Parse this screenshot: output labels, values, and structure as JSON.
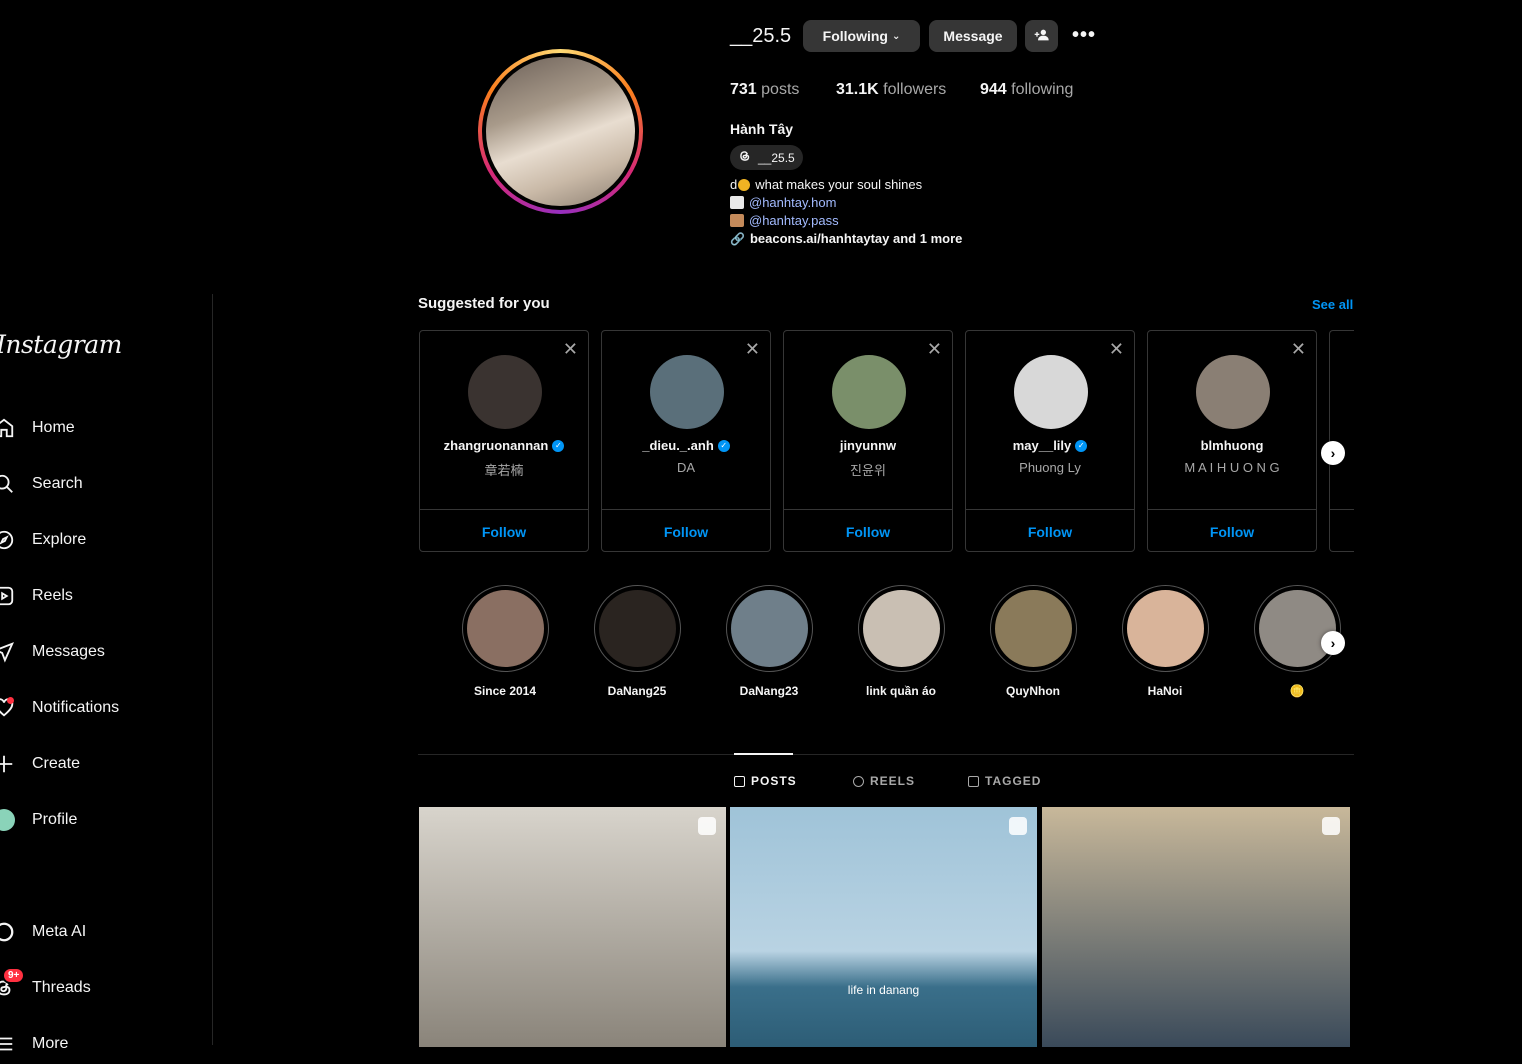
{
  "sidebar": {
    "logo": "Instagram",
    "items": [
      {
        "label": "Home",
        "icon": "home-icon"
      },
      {
        "label": "Search",
        "icon": "search-icon"
      },
      {
        "label": "Explore",
        "icon": "compass-icon"
      },
      {
        "label": "Reels",
        "icon": "reels-icon"
      },
      {
        "label": "Messages",
        "icon": "send-icon"
      },
      {
        "label": "Notifications",
        "icon": "heart-icon"
      },
      {
        "label": "Create",
        "icon": "plus-icon"
      },
      {
        "label": "Profile",
        "icon": "avatar"
      },
      {
        "label": "Meta AI",
        "icon": "meta-ai-icon"
      },
      {
        "label": "Threads",
        "icon": "threads-icon",
        "badge": "9+"
      },
      {
        "label": "More",
        "icon": "menu-icon"
      }
    ]
  },
  "profile": {
    "username": "__25.5",
    "following_btn": "Following",
    "message_btn": "Message",
    "posts_count": "731",
    "posts_label": "posts",
    "followers_count": "31.1K",
    "followers_label": "followers",
    "following_count": "944",
    "following_label": "following",
    "full_name": "Hành Tây",
    "threads_handle": "__25.5",
    "bio_line1": "what makes your soul shines",
    "bio_line1_prefix": "d",
    "bio_link1": "@hanhtay.hom",
    "bio_link2": "@hanhtay.pass",
    "bio_link3": "beacons.ai/hanhtaytay and 1 more"
  },
  "suggested": {
    "title": "Suggested for you",
    "see_all": "See all",
    "follow_label": "Follow",
    "cards": [
      {
        "username": "zhangruonannan",
        "subtitle": "章若楠",
        "verified": true,
        "color": "#3a3330"
      },
      {
        "username": "_dieu._.anh",
        "subtitle": "DA",
        "verified": true,
        "color": "#5a6f7a"
      },
      {
        "username": "jinyunnw",
        "subtitle": "진윤위",
        "verified": false,
        "color": "#7a8f6a"
      },
      {
        "username": "may__lily",
        "subtitle": "Phuong Ly",
        "verified": true,
        "color": "#d8d8d8"
      },
      {
        "username": "blmhuong",
        "subtitle": "M A I H U O N G",
        "verified": false,
        "color": "#8a7f74"
      }
    ]
  },
  "highlights": [
    {
      "label": "Since 2014",
      "color": "#8a6f62"
    },
    {
      "label": "DaNang25",
      "color": "#2a2420"
    },
    {
      "label": "DaNang23",
      "color": "#6f7f8a"
    },
    {
      "label": "link quần áo",
      "color": "#c9bfb3"
    },
    {
      "label": "QuyNhon",
      "color": "#8a7a5a"
    },
    {
      "label": "HaNoi",
      "color": "#d9b49a"
    },
    {
      "label": "🪙",
      "color": "#8f8a84"
    }
  ],
  "tabs": [
    {
      "label": "POSTS",
      "active": true
    },
    {
      "label": "REELS",
      "active": false
    },
    {
      "label": "TAGGED",
      "active": false
    }
  ],
  "posts": [
    {
      "caption": "",
      "color_top": "#d8d4cc",
      "color_bottom": "#8a847a"
    },
    {
      "caption": "life in danang",
      "color_top": "#9fc3d8",
      "color_bottom": "#3a6f8a"
    },
    {
      "caption": "",
      "color_top": "#c8b89a",
      "color_bottom": "#3a4a5a"
    }
  ],
  "colors": {
    "accent": "#0095f6",
    "badge": "#ff3040",
    "button": "#363636"
  }
}
